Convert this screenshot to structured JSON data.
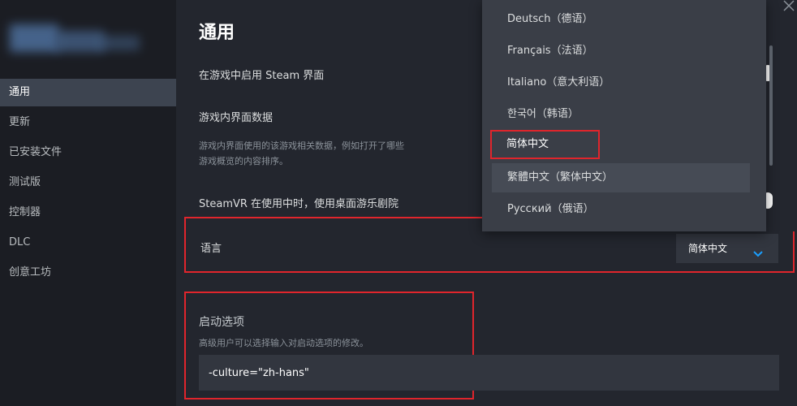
{
  "sidebar": {
    "items": [
      {
        "label": "通用",
        "active": true
      },
      {
        "label": "更新"
      },
      {
        "label": "已安装文件"
      },
      {
        "label": "测试版"
      },
      {
        "label": "控制器"
      },
      {
        "label": "DLC"
      },
      {
        "label": "创意工坊"
      }
    ]
  },
  "main": {
    "title": "通用",
    "overlay_label": "在游戏中启用 Steam 界面",
    "ingame_data_label": "游戏内界面数据",
    "ingame_data_desc_line1": "游戏内界面使用的该游戏相关数据，例如打开了哪些",
    "ingame_data_desc_line2": "游戏概览的内容排序。",
    "steamvr_label": "SteamVR 在使用中时，使用桌面游乐剧院",
    "language_label": "语言",
    "language_selected": "简体中文",
    "launch_title": "启动选项",
    "launch_desc": "高级用户可以选择输入对启动选项的修改。",
    "launch_value": "-culture=\"zh-hans\""
  },
  "dropdown": {
    "options": [
      "Deutsch（德语）",
      "Français（法语）",
      "Italiano（意大利语）",
      "한국어（韩语）",
      "简体中文",
      "繁體中文（繁体中文）",
      "Русский（俄语）"
    ]
  },
  "colors": {
    "highlight_red": "#e0252c",
    "accent_blue": "#1a9fff"
  }
}
